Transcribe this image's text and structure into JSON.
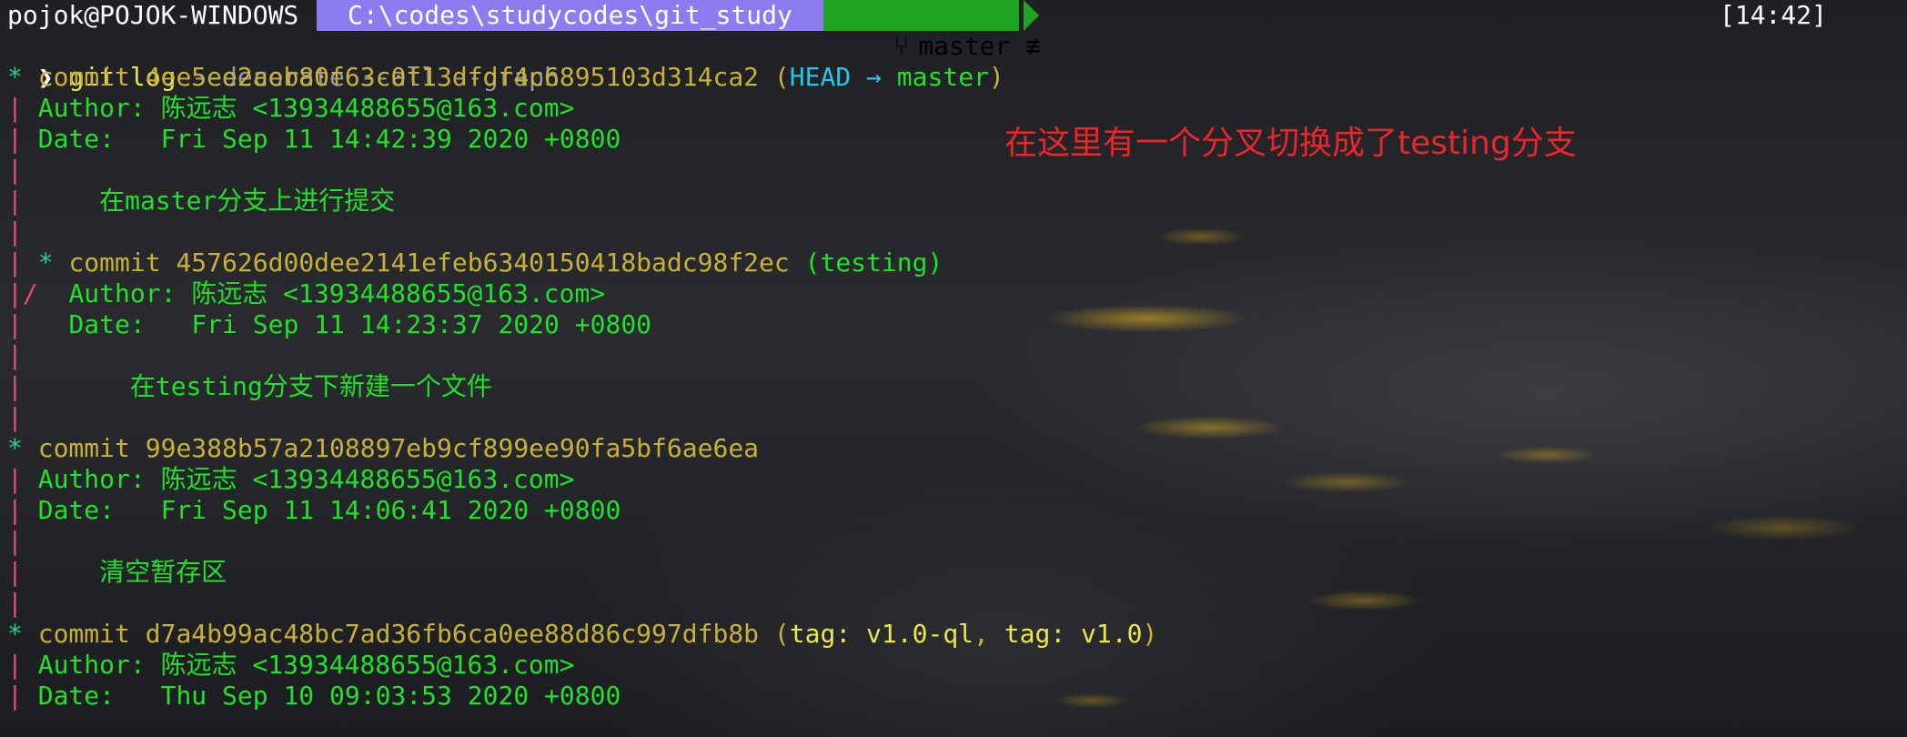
{
  "prompt": {
    "user_host": "pojok@POJOK-WINDOWS",
    "path": "C:\\codes\\studycodes\\git_study",
    "branch_icon": "",
    "branch": "master ≢",
    "time": "[14:42]",
    "chevron": "❯",
    "command": "git log",
    "args": "--decorate --all --graph"
  },
  "commits": [
    {
      "graph": "*",
      "label": "commit",
      "hash": "4ee5ee2aeb80f63c0f13dfdf4c6895103d314ca2",
      "ref_open": "(",
      "head": "HEAD",
      "ref_arrow": "→",
      "ref_branch": "master",
      "ref_close": ")",
      "author_label": "Author:",
      "author": "陈远志 <13934488655@163.com>",
      "date_label": "Date:",
      "date": "Fri Sep 11 14:42:39 2020 +0800",
      "message": "在master分支上进行提交"
    },
    {
      "graph": "* ",
      "label": "commit",
      "hash": "457626d00dee2141efeb6340150418badc98f2ec",
      "ref": "(testing)",
      "author_label": "Author:",
      "author": "陈远志 <13934488655@163.com>",
      "date_label": "Date:",
      "date": "Fri Sep 11 14:23:37 2020 +0800",
      "message": "在testing分支下新建一个文件"
    },
    {
      "graph": "*",
      "label": "commit",
      "hash": "99e388b57a2108897eb9cf899ee90fa5bf6ae6ea",
      "author_label": "Author:",
      "author": "陈远志 <13934488655@163.com>",
      "date_label": "Date:",
      "date": "Fri Sep 11 14:06:41 2020 +0800",
      "message": "清空暂存区"
    },
    {
      "graph": "*",
      "label": "commit",
      "hash": "d7a4b99ac48bc7ad36fb6ca0ee88d86c997dfb8b",
      "ref_open": "(",
      "tag1": "tag: v1.0-ql",
      "ref_sep": ",",
      "tag2": "tag: v1.0",
      "ref_close": ")",
      "author_label": "Author:",
      "author": "陈远志 <13934488655@163.com>",
      "date_label": "Date:",
      "date": "Thu Sep 10 09:03:53 2020 +0800"
    }
  ],
  "graph_chars": {
    "pipe": "|",
    "merge": "|/"
  },
  "annotation": "在这里有一个分叉切换成了testing分支",
  "colors": {
    "path_bg": "#8b7cf0",
    "branch_bg": "#1fa320",
    "hash": "#c8b13a",
    "green": "#22e02b",
    "cyan": "#25c6e8",
    "pipe": "#e04d78",
    "annotation": "#e8262c"
  }
}
